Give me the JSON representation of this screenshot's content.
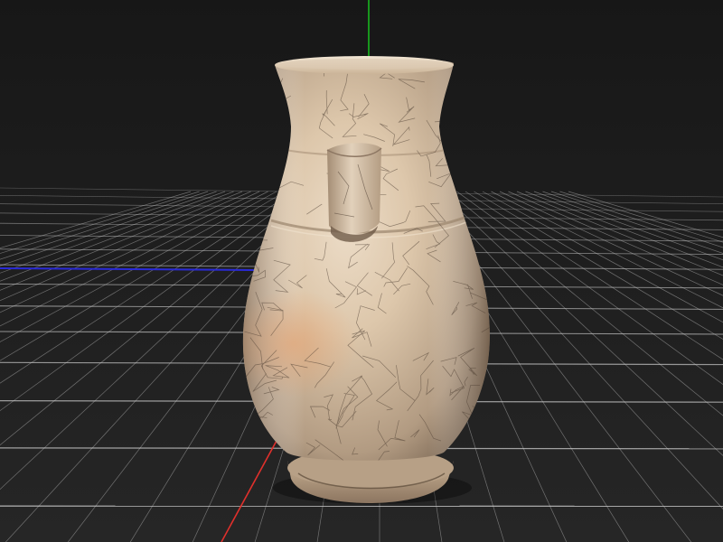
{
  "viewport": {
    "background_color": "#1d1d1d",
    "top_band_color": "#161616"
  },
  "grid": {
    "visible": true,
    "line_color": "#cfcfcf"
  },
  "axes": {
    "x_color": "#e0302c",
    "y_color": "#19b81f",
    "z_color": "#2a2ad8"
  },
  "model": {
    "name": "crackle-glaze-vase",
    "glaze_color": "#d9c3a7",
    "shadow_color": "#7b6652",
    "crackle_color": "#4f4034"
  }
}
